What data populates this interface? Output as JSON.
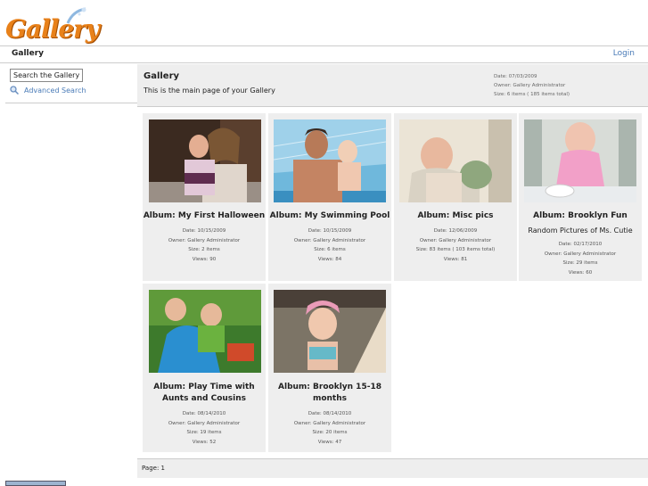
{
  "header": {
    "logo_text": "Gallery"
  },
  "breadcrumb": {
    "current": "Gallery",
    "login_label": "Login"
  },
  "sidebar": {
    "search_value": "Search the Gallery",
    "advanced_search": "Advanced Search"
  },
  "gallery": {
    "title": "Gallery",
    "description": "This is the main page of your Gallery",
    "date": "Date: 07/03/2009",
    "owner": "Owner: Gallery Administrator",
    "size": "Size: 6 items ( 185 items total)"
  },
  "albums": [
    {
      "title": "Album: My First Halloween",
      "date": "Date: 10/15/2009",
      "owner": "Owner: Gallery Administrator",
      "size": "Size: 2 items",
      "views": "Views: 90"
    },
    {
      "title": "Album: My Swimming Pool",
      "date": "Date: 10/15/2009",
      "owner": "Owner: Gallery Administrator",
      "size": "Size: 6 items",
      "views": "Views: 84"
    },
    {
      "title": "Album: Misc pics",
      "date": "Date: 12/06/2009",
      "owner": "Owner: Gallery Administrator",
      "size": "Size: 83 items ( 103 items total)",
      "views": "Views: 81"
    },
    {
      "title": "Album: Brooklyn Fun",
      "extra": "Random Pictures of Ms. Cutie",
      "date": "Date: 02/17/2010",
      "owner": "Owner: Gallery Administrator",
      "size": "Size: 29 items",
      "views": "Views: 60"
    },
    {
      "title": "Album: Play Time with",
      "title2": "Aunts and Cousins",
      "date": "Date: 08/14/2010",
      "owner": "Owner: Gallery Administrator",
      "size": "Size: 19 items",
      "views": "Views: 52"
    },
    {
      "title": "Album: Brooklyn 15-18",
      "title2": "months",
      "date": "Date: 08/14/2010",
      "owner": "Owner: Gallery Administrator",
      "size": "Size: 20 items",
      "views": "Views: 47"
    }
  ],
  "pager": {
    "label": "Page:",
    "page": "1"
  }
}
